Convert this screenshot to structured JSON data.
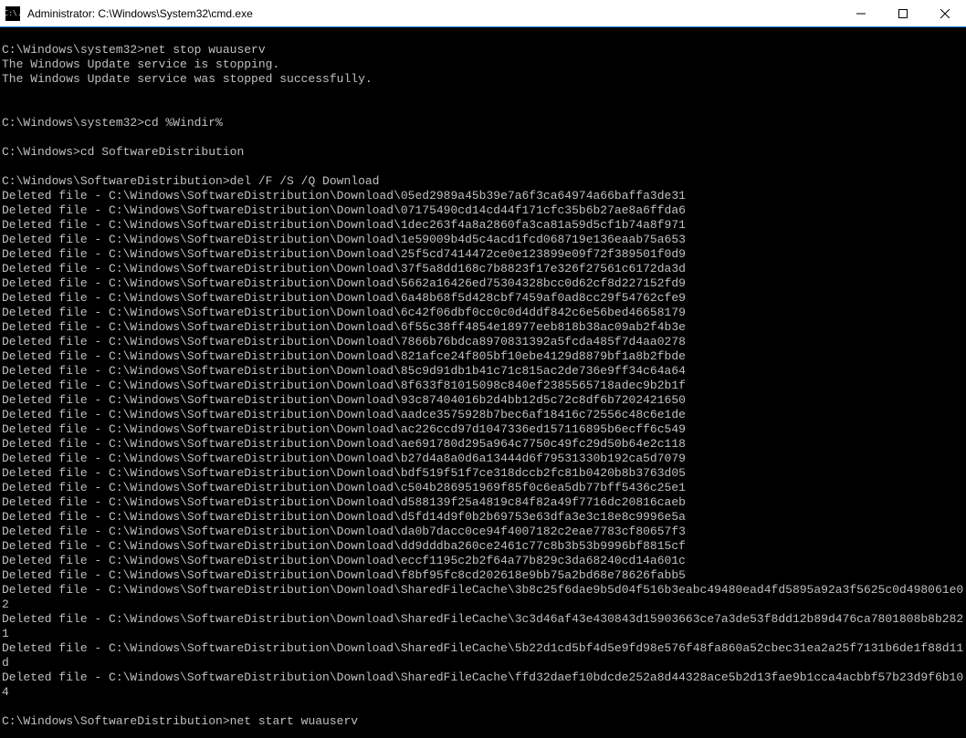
{
  "window": {
    "title": "Administrator: C:\\Windows\\System32\\cmd.exe",
    "icon_text": "C:\\."
  },
  "terminal": {
    "lines": [
      {
        "type": "empty"
      },
      {
        "type": "command",
        "prompt": "C:\\Windows\\system32>",
        "cmd": "net stop wuauserv"
      },
      {
        "type": "output",
        "text": "The Windows Update service is stopping."
      },
      {
        "type": "output",
        "text": "The Windows Update service was stopped successfully."
      },
      {
        "type": "empty"
      },
      {
        "type": "empty"
      },
      {
        "type": "command",
        "prompt": "C:\\Windows\\system32>",
        "cmd": "cd %Windir%"
      },
      {
        "type": "empty"
      },
      {
        "type": "command",
        "prompt": "C:\\Windows>",
        "cmd": "cd SoftwareDistribution"
      },
      {
        "type": "empty"
      },
      {
        "type": "command",
        "prompt": "C:\\Windows\\SoftwareDistribution>",
        "cmd": "del /F /S /Q Download"
      },
      {
        "type": "output",
        "text": "Deleted file - C:\\Windows\\SoftwareDistribution\\Download\\05ed2989a45b39e7a6f3ca64974a66baffa3de31"
      },
      {
        "type": "output",
        "text": "Deleted file - C:\\Windows\\SoftwareDistribution\\Download\\07175490cd14cd44f171cfc35b6b27ae8a6ffda6"
      },
      {
        "type": "output",
        "text": "Deleted file - C:\\Windows\\SoftwareDistribution\\Download\\1dec263f4a8a2860fa3ca81a59d5cf1b74a8f971"
      },
      {
        "type": "output",
        "text": "Deleted file - C:\\Windows\\SoftwareDistribution\\Download\\1e59009b4d5c4acd1fcd068719e136eaab75a653"
      },
      {
        "type": "output",
        "text": "Deleted file - C:\\Windows\\SoftwareDistribution\\Download\\25f5cd7414472ce0e123899e09f72f389501f0d9"
      },
      {
        "type": "output",
        "text": "Deleted file - C:\\Windows\\SoftwareDistribution\\Download\\37f5a8dd168c7b8823f17e326f27561c6172da3d"
      },
      {
        "type": "output",
        "text": "Deleted file - C:\\Windows\\SoftwareDistribution\\Download\\5662a16426ed75304328bcc0d62cf8d227152fd9"
      },
      {
        "type": "output",
        "text": "Deleted file - C:\\Windows\\SoftwareDistribution\\Download\\6a48b68f5d428cbf7459af0ad8cc29f54762cfe9"
      },
      {
        "type": "output",
        "text": "Deleted file - C:\\Windows\\SoftwareDistribution\\Download\\6c42f06dbf0cc0c0d4ddf842c6e56bed46658179"
      },
      {
        "type": "output",
        "text": "Deleted file - C:\\Windows\\SoftwareDistribution\\Download\\6f55c38ff4854e18977eeb818b38ac09ab2f4b3e"
      },
      {
        "type": "output",
        "text": "Deleted file - C:\\Windows\\SoftwareDistribution\\Download\\7866b76bdca8970831392a5fcda485f7d4aa0278"
      },
      {
        "type": "output",
        "text": "Deleted file - C:\\Windows\\SoftwareDistribution\\Download\\821afce24f805bf10ebe4129d8879bf1a8b2fbde"
      },
      {
        "type": "output",
        "text": "Deleted file - C:\\Windows\\SoftwareDistribution\\Download\\85c9d91db1b41c71c815ac2de736e9ff34c64a64"
      },
      {
        "type": "output",
        "text": "Deleted file - C:\\Windows\\SoftwareDistribution\\Download\\8f633f81015098c840ef2385565718adec9b2b1f"
      },
      {
        "type": "output",
        "text": "Deleted file - C:\\Windows\\SoftwareDistribution\\Download\\93c87404016b2d4bb12d5c72c8df6b7202421650"
      },
      {
        "type": "output",
        "text": "Deleted file - C:\\Windows\\SoftwareDistribution\\Download\\aadce3575928b7bec6af18416c72556c48c6e1de"
      },
      {
        "type": "output",
        "text": "Deleted file - C:\\Windows\\SoftwareDistribution\\Download\\ac226ccd97d1047336ed157116895b6ecff6c549"
      },
      {
        "type": "output",
        "text": "Deleted file - C:\\Windows\\SoftwareDistribution\\Download\\ae691780d295a964c7750c49fc29d50b64e2c118"
      },
      {
        "type": "output",
        "text": "Deleted file - C:\\Windows\\SoftwareDistribution\\Download\\b27d4a8a0d6a13444d6f79531330b192ca5d7079"
      },
      {
        "type": "output",
        "text": "Deleted file - C:\\Windows\\SoftwareDistribution\\Download\\bdf519f51f7ce318dccb2fc81b0420b8b3763d05"
      },
      {
        "type": "output",
        "text": "Deleted file - C:\\Windows\\SoftwareDistribution\\Download\\c504b286951969f85f0c6ea5db77bff5436c25e1"
      },
      {
        "type": "output",
        "text": "Deleted file - C:\\Windows\\SoftwareDistribution\\Download\\d588139f25a4819c84f82a49f7716dc20816caeb"
      },
      {
        "type": "output",
        "text": "Deleted file - C:\\Windows\\SoftwareDistribution\\Download\\d5fd14d9f0b2b69753e63dfa3e3c18e8c9996e5a"
      },
      {
        "type": "output",
        "text": "Deleted file - C:\\Windows\\SoftwareDistribution\\Download\\da0b7dacc0ce94f4007182c2eae7783cf80657f3"
      },
      {
        "type": "output",
        "text": "Deleted file - C:\\Windows\\SoftwareDistribution\\Download\\dd9dddba260ce2461c77c8b3b53b9996bf8815cf"
      },
      {
        "type": "output",
        "text": "Deleted file - C:\\Windows\\SoftwareDistribution\\Download\\eccf1195c2b2f64a77b829c3da68240cd14a601c"
      },
      {
        "type": "output",
        "text": "Deleted file - C:\\Windows\\SoftwareDistribution\\Download\\f8bf95fc8cd202618e9bb75a2bd68e78626fabb5"
      },
      {
        "type": "output",
        "text": "Deleted file - C:\\Windows\\SoftwareDistribution\\Download\\SharedFileCache\\3b8c25f6dae9b5d04f516b3eabc49480ead4fd5895a92a3f5625c0d498061e02"
      },
      {
        "type": "output",
        "text": "Deleted file - C:\\Windows\\SoftwareDistribution\\Download\\SharedFileCache\\3c3d46af43e430843d15903663ce7a3de53f8dd12b89d476ca7801808b8b2821"
      },
      {
        "type": "output",
        "text": "Deleted file - C:\\Windows\\SoftwareDistribution\\Download\\SharedFileCache\\5b22d1cd5bf4d5e9fd98e576f48fa860a52cbec31ea2a25f7131b6de1f88d11d"
      },
      {
        "type": "output",
        "text": "Deleted file - C:\\Windows\\SoftwareDistribution\\Download\\SharedFileCache\\ffd32daef10bdcde252a8d44328ace5b2d13fae9b1cca4acbbf57b23d9f6b104"
      },
      {
        "type": "empty"
      },
      {
        "type": "command",
        "prompt": "C:\\Windows\\SoftwareDistribution>",
        "cmd": "net start wuauserv"
      }
    ]
  }
}
